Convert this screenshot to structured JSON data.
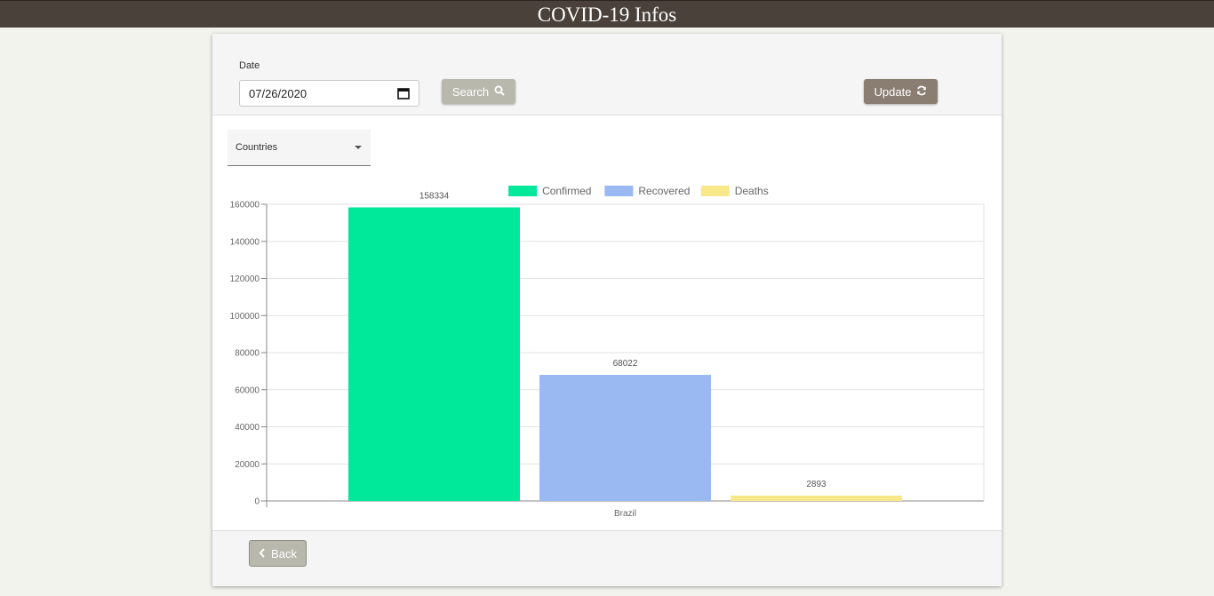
{
  "header": {
    "title": "COVID-19 Infos"
  },
  "filters": {
    "date_label": "Date",
    "date_value": "07/26/2020",
    "search_label": "Search",
    "update_label": "Update",
    "countries_placeholder": "Countries"
  },
  "footer": {
    "back_label": "Back"
  },
  "colors": {
    "header_bg": "#4a413a",
    "confirmed": "#00e89a",
    "recovered": "#9ab8f2",
    "deaths": "#f8e88a",
    "update_button": "#8a7d72",
    "search_button": "#b8b8ad"
  },
  "icons": [
    "calendar-icon",
    "search-icon",
    "refresh-icon",
    "chevron-left-icon",
    "caret-down-icon"
  ],
  "chart_data": {
    "type": "bar",
    "categories": [
      "Brazil"
    ],
    "series": [
      {
        "name": "Confirmed",
        "values": [
          158334
        ],
        "color": "#00e89a"
      },
      {
        "name": "Recovered",
        "values": [
          68022
        ],
        "color": "#9ab8f2"
      },
      {
        "name": "Deaths",
        "values": [
          2893
        ],
        "color": "#f8e88a"
      }
    ],
    "ylim": [
      0,
      160000
    ],
    "yticks": [
      0,
      20000,
      40000,
      60000,
      80000,
      100000,
      120000,
      140000,
      160000
    ],
    "data_labels": true,
    "grid": true,
    "legend_position": "top-center"
  }
}
